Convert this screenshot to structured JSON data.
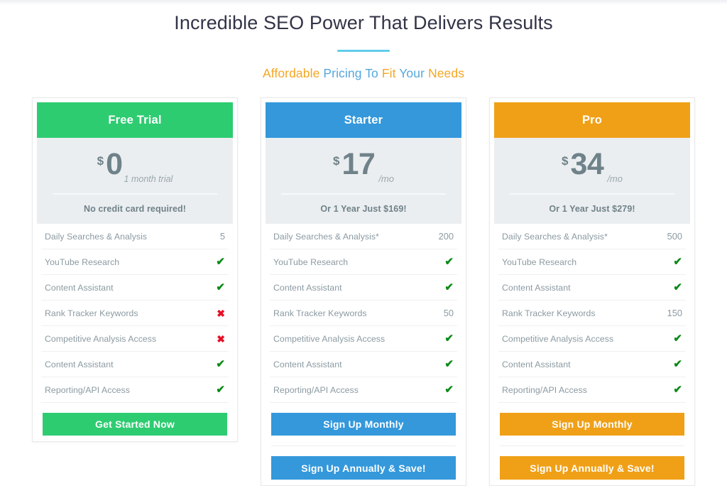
{
  "header": {
    "title": "Incredible SEO Power That Delivers Results",
    "subtitle_parts": [
      {
        "text": "Affordable",
        "color": "orange"
      },
      {
        "text": "Pricing To",
        "color": "blue"
      },
      {
        "text": "Fit",
        "color": "orange"
      },
      {
        "text": "Your",
        "color": "blue"
      },
      {
        "text": "Needs",
        "color": "orange"
      }
    ]
  },
  "colors": {
    "green": "#2ecc71",
    "blue": "#3498db",
    "orange": "#f0a017",
    "accent_rule": "#62cdec",
    "check": "#0b8a17",
    "cross": "#e60f26",
    "price_block_bg": "#ebeef0"
  },
  "plans": [
    {
      "name": "Free Trial",
      "theme": "green",
      "currency": "$",
      "amount": "0",
      "period": "1 month trial",
      "note": "No credit card required!",
      "features": [
        {
          "label": "Daily Searches & Analysis",
          "value": "5",
          "type": "text"
        },
        {
          "label": "YouTube Research",
          "value": "✔",
          "type": "check"
        },
        {
          "label": "Content Assistant",
          "value": "✔",
          "type": "check"
        },
        {
          "label": "Rank Tracker Keywords",
          "value": "✖",
          "type": "cross"
        },
        {
          "label": "Competitive Analysis Access",
          "value": "✖",
          "type": "cross"
        },
        {
          "label": "Content Assistant",
          "value": "✔",
          "type": "check"
        },
        {
          "label": "Reporting/API Access",
          "value": "✔",
          "type": "check"
        }
      ],
      "buttons": [
        {
          "label": "Get Started Now",
          "name": "get-started-now-button"
        }
      ]
    },
    {
      "name": "Starter",
      "theme": "blue",
      "currency": "$",
      "amount": "17",
      "period": "/mo",
      "note": "Or 1 Year Just $169!",
      "features": [
        {
          "label": "Daily Searches & Analysis*",
          "value": "200",
          "type": "text"
        },
        {
          "label": "YouTube Research",
          "value": "✔",
          "type": "check"
        },
        {
          "label": "Content Assistant",
          "value": "✔",
          "type": "check"
        },
        {
          "label": "Rank Tracker Keywords",
          "value": "50",
          "type": "text"
        },
        {
          "label": "Competitive Analysis Access",
          "value": "✔",
          "type": "check"
        },
        {
          "label": "Content Assistant",
          "value": "✔",
          "type": "check"
        },
        {
          "label": "Reporting/API Access",
          "value": "✔",
          "type": "check"
        }
      ],
      "buttons": [
        {
          "label": "Sign Up Monthly",
          "name": "sign-up-monthly-button"
        },
        {
          "label": "Sign Up Annually & Save!",
          "name": "sign-up-annually-button"
        }
      ]
    },
    {
      "name": "Pro",
      "theme": "orange",
      "currency": "$",
      "amount": "34",
      "period": "/mo",
      "note": "Or 1 Year Just $279!",
      "features": [
        {
          "label": "Daily Searches & Analysis*",
          "value": "500",
          "type": "text"
        },
        {
          "label": "YouTube Research",
          "value": "✔",
          "type": "check"
        },
        {
          "label": "Content Assistant",
          "value": "✔",
          "type": "check"
        },
        {
          "label": "Rank Tracker Keywords",
          "value": "150",
          "type": "text"
        },
        {
          "label": "Competitive Analysis Access",
          "value": "✔",
          "type": "check"
        },
        {
          "label": "Content Assistant",
          "value": "✔",
          "type": "check"
        },
        {
          "label": "Reporting/API Access",
          "value": "✔",
          "type": "check"
        }
      ],
      "buttons": [
        {
          "label": "Sign Up Monthly",
          "name": "sign-up-monthly-button"
        },
        {
          "label": "Sign Up Annually & Save!",
          "name": "sign-up-annually-button"
        }
      ]
    }
  ]
}
